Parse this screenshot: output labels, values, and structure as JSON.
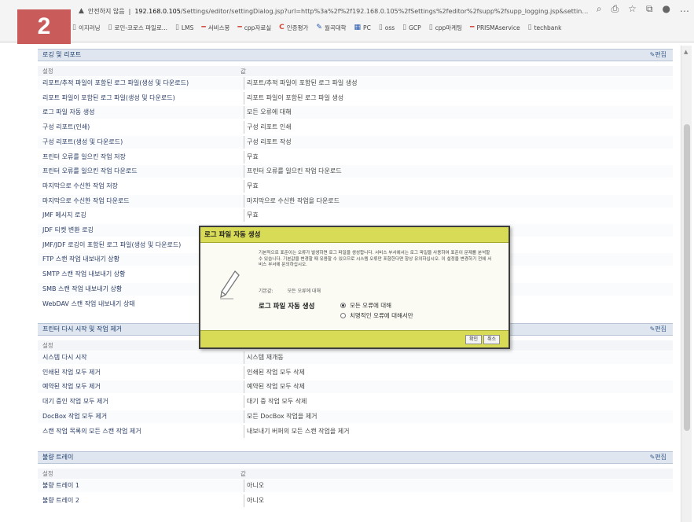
{
  "step_badge": "2",
  "browser": {
    "security_label": "안전하지 않음",
    "url_host": "192.168.0.105",
    "url_rest": "/Settings/editor/settingDialog.jsp?url=http%3a%2f%2f192.168.0.105%2fSettings%2feditor%2fsupp%2fsupp_logging.jsp&settingId=/Logging/...",
    "bookmarks": [
      {
        "label": "이지러닝",
        "icon": "page-icon"
      },
      {
        "label": "로인-코로스 파일로...",
        "icon": "page-icon"
      },
      {
        "label": "LMS",
        "icon": "page-icon"
      },
      {
        "label": "서비스봉",
        "icon": "dash-icon"
      },
      {
        "label": "cpp자료실",
        "icon": "dash-icon"
      },
      {
        "label": "인증평가",
        "icon": "c-icon"
      },
      {
        "label": "월곡대학",
        "icon": "pen-icon"
      },
      {
        "label": "PC",
        "icon": "grid-icon"
      },
      {
        "label": "oss",
        "icon": "page-icon"
      },
      {
        "label": "GCP",
        "icon": "page-icon"
      },
      {
        "label": "cpp마케팅",
        "icon": "page-icon"
      },
      {
        "label": "PRISMAservice",
        "icon": "dash-icon"
      },
      {
        "label": "techbank",
        "icon": "page-icon"
      }
    ]
  },
  "sections": {
    "logging": {
      "title": "로깅 및 리포트",
      "edit": "편집",
      "col_setting": "설정",
      "col_value": "값",
      "rows": [
        {
          "label": "리포트/추적 파일이 포함된 로그 파일(생성 및 다운로드)",
          "value": "리포트/추적 파일이 포함된 로그 파일 생성"
        },
        {
          "label": "리포트 파일이 포함된 로그 파일(생성 및 다운로드)",
          "value": "리포트 파일이 포함된 로그 파일 생성"
        },
        {
          "label": "로그 파일 자동 생성",
          "value": "모든 오류에 대해"
        },
        {
          "label": "구성 리포트(인쇄)",
          "value": "구성 리포트 인쇄"
        },
        {
          "label": "구성 리포트(생성 및 다운로드)",
          "value": "구성 리포트 작성"
        },
        {
          "label": "프린터 오류를 일으킨 작업 저장",
          "value": "무효"
        },
        {
          "label": "프린터 오류를 일으킨 작업 다운로드",
          "value": "프린터 오류를 일으킨 작업 다운로드"
        },
        {
          "label": "마지막으로 수신한 작업 저장",
          "value": "무효"
        },
        {
          "label": "마지막으로 수신한 작업 다운로드",
          "value": "마지막으로 수신한 작업을 다운로드"
        },
        {
          "label": "JMF 메시지 로깅",
          "value": "무효"
        },
        {
          "label": "JDF 티켓 변환 로깅",
          "value": ""
        },
        {
          "label": "JMF/JDF 로깅이 포함된 로그 파일(생성 및 다운로드)",
          "value": ""
        },
        {
          "label": "FTP 스캔 작업 내보내기 상황",
          "value": ""
        },
        {
          "label": "SMTP 스캔 작업 내보내기 상황",
          "value": ""
        },
        {
          "label": "SMB 스캔 작업 내보내기 상황",
          "value": ""
        },
        {
          "label": "WebDAV 스캔 작업 내보내기 상태",
          "value": ""
        }
      ]
    },
    "restart": {
      "title": "프린터 다시 시작 및 작업 제거",
      "edit": "편집",
      "col_setting": "설정",
      "rows": [
        {
          "label": "시스템 다시 시작",
          "value": "시스템 재개동"
        },
        {
          "label": "인쇄된 작업 모두 제거",
          "value": "인쇄된 작업 모두 삭제"
        },
        {
          "label": "예약된 작업 모두 제거",
          "value": "예약된 작업 모두 삭제"
        },
        {
          "label": "대기 중인 작업 모두 제거",
          "value": "대기 중 작업 모두 삭제"
        },
        {
          "label": "DocBox 작업 모두 제거",
          "value": "모든 DocBox 작업을 제거"
        },
        {
          "label": "스캔 작업 목록의 모든 스캔 작업 제거",
          "value": "내보내기 버퍼의 모든 스캔 작업을 제거"
        }
      ]
    },
    "tray": {
      "title": "불량 트레이",
      "edit": "편집",
      "col_setting": "설정",
      "col_value": "값",
      "rows": [
        {
          "label": "불량 트레이 1",
          "value": "아니오"
        },
        {
          "label": "불량 트레이 2",
          "value": "아니오"
        }
      ]
    }
  },
  "dialog": {
    "title": "로그 파일 자동 생성",
    "description": "기본적으로 표준이는 오류가 발생하면 로그 파일을 생성합니다. 서비스 부서에서는 로그 파일을 사용하여 표준이 문제를 분석할 수 있습니다. 기본값을 변경할 때 유용할 수 있으므로 시스템 오류만 포함한다면 항상 유의하십시오. 이 설정을 변경하기 전에 서비스 부서에 문의하십시오.",
    "base_label": "기본값:",
    "base_value": "모든 오류에 대해",
    "setting_label": "로그 파일 자동 생성",
    "options": [
      "모든 오류에 대해",
      "치명적인 오류에 대해서만"
    ],
    "selected": 0,
    "ok": "확인",
    "cancel": "취소"
  }
}
